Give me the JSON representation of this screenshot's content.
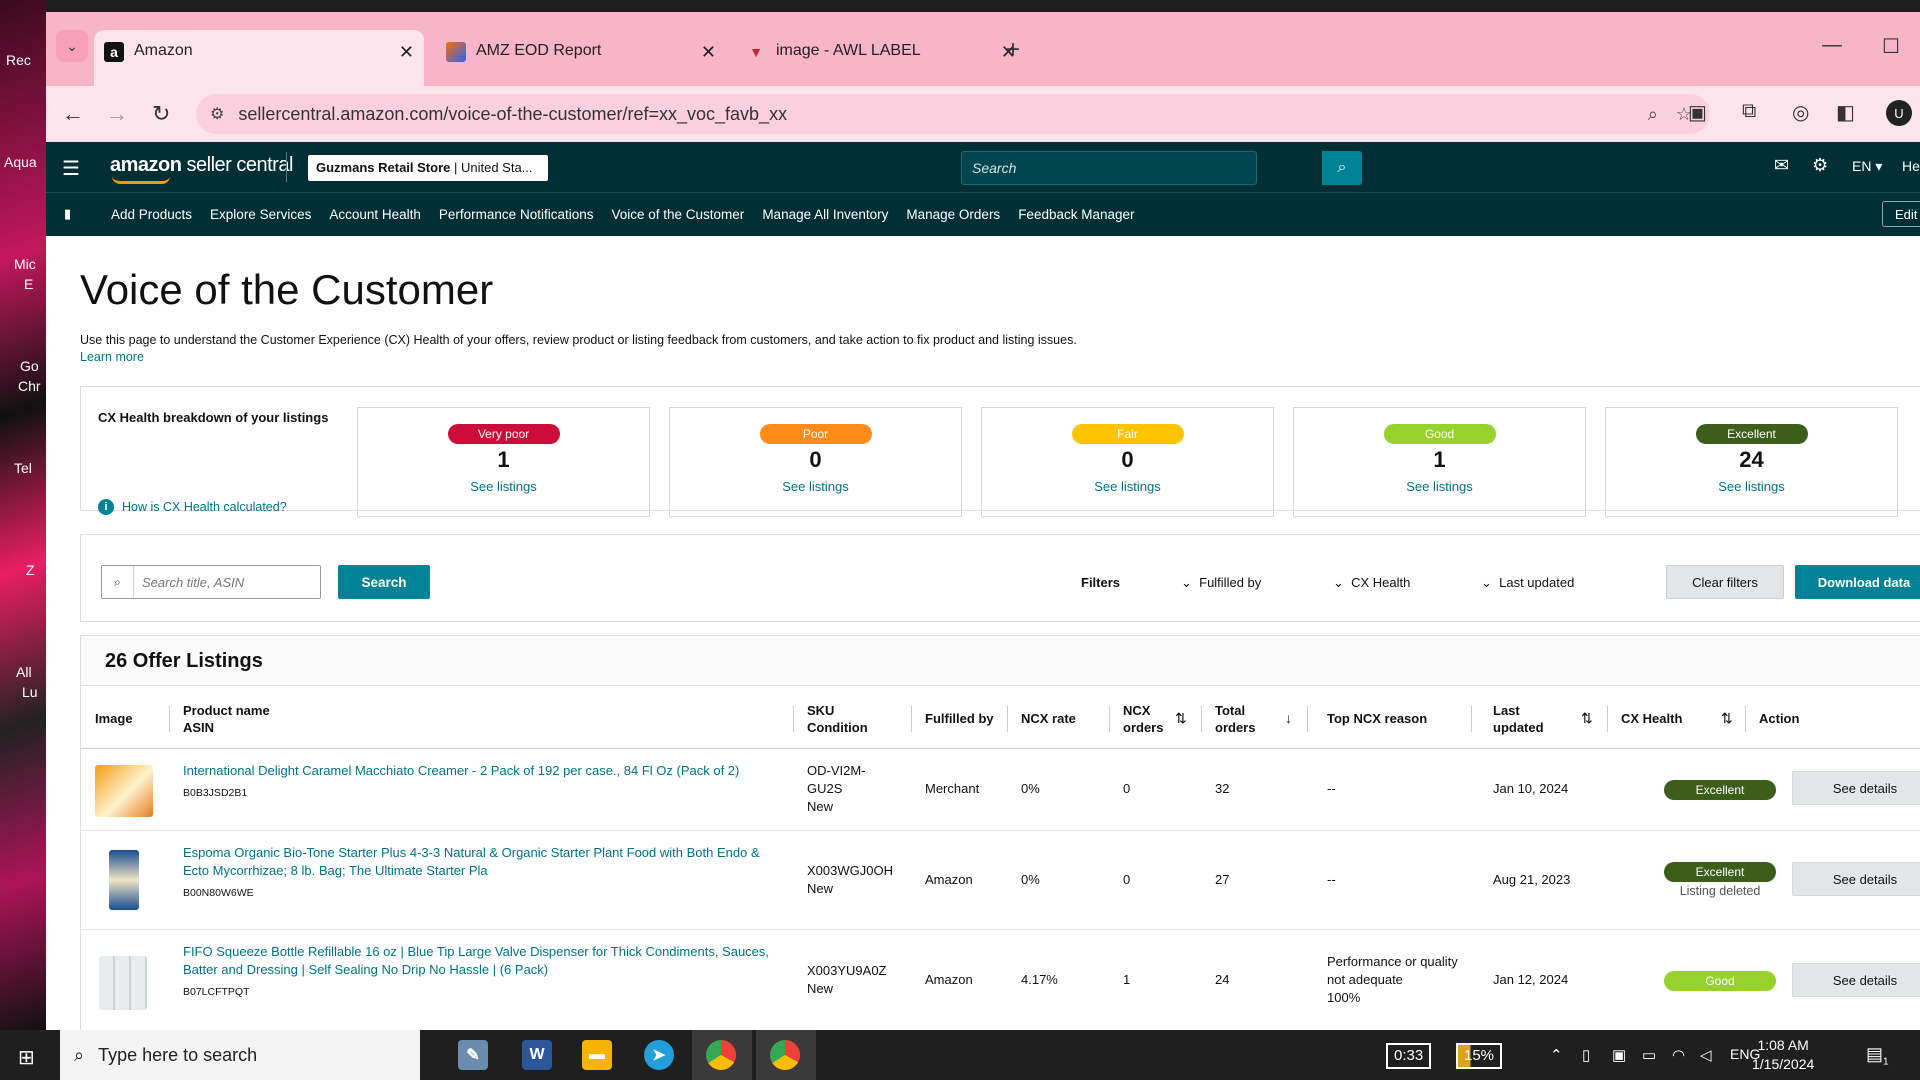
{
  "desktop": {
    "labels": [
      "Rec",
      "Aqua",
      "Mic",
      "E",
      "Go",
      "Chr",
      "Tel",
      "Z",
      "All",
      "Lu"
    ]
  },
  "browser": {
    "tabs": [
      {
        "title": "Amazon",
        "favicon": "a"
      },
      {
        "title": "AMZ EOD Report",
        "favicon": ""
      },
      {
        "title": "image - AWL LABEL",
        "favicon": ""
      }
    ],
    "url": "sellercentral.amazon.com/voice-of-the-customer/ref=xx_voc_favb_xx",
    "avatar": "U"
  },
  "header": {
    "logo_bold": "amazon",
    "logo_rest": " seller central",
    "store_name": "Guzmans Retail Store",
    "store_market": " | United Sta...",
    "search_placeholder": "Search",
    "lang": "EN ▾",
    "help": "He"
  },
  "nav": {
    "items": [
      "Add Products",
      "Explore Services",
      "Account Health",
      "Performance Notifications",
      "Voice of the Customer",
      "Manage All Inventory",
      "Manage Orders",
      "Feedback Manager"
    ],
    "edit": "Edit"
  },
  "page": {
    "title": "Voice of the Customer",
    "description": "Use this page to understand the Customer Experience (CX) Health of your offers, review product or listing feedback from customers, and take action to fix product and listing issues.",
    "learn_more": "Learn more"
  },
  "cx_health": {
    "title": "CX Health breakdown of your listings",
    "how_link": "How is CX Health calculated?",
    "cards": [
      {
        "label": "Very poor",
        "count": "1",
        "link": "See listings",
        "color": "#cc0c39"
      },
      {
        "label": "Poor",
        "count": "0",
        "link": "See listings",
        "color": "#ff8c1a"
      },
      {
        "label": "Fair",
        "count": "0",
        "link": "See listings",
        "color": "#ffc400"
      },
      {
        "label": "Good",
        "count": "1",
        "link": "See listings",
        "color": "#97d12b"
      },
      {
        "label": "Excellent",
        "count": "24",
        "link": "See listings",
        "color": "#3d5d1a"
      }
    ]
  },
  "filters": {
    "search_placeholder": "Search title, ASIN",
    "search_button": "Search",
    "filters_label": "Filters",
    "fulfilled_by": "Fulfilled by",
    "cx_health": "CX Health",
    "last_updated": "Last updated",
    "clear": "Clear filters",
    "download": "Download data"
  },
  "listings": {
    "heading": "26 Offer Listings",
    "columns": {
      "image": "Image",
      "product_name": "Product name",
      "asin": "ASIN",
      "sku": "SKU",
      "condition": "Condition",
      "fulfilled_by": "Fulfilled by",
      "ncx_rate": "NCX rate",
      "ncx_orders_1": "NCX",
      "ncx_orders_2": "orders",
      "total_orders_1": "Total",
      "total_orders_2": "orders",
      "top_reason": "Top NCX reason",
      "last_updated_1": "Last",
      "last_updated_2": "updated",
      "cx_health": "CX Health",
      "action": "Action"
    },
    "rows": [
      {
        "name": "International Delight Caramel Macchiato Creamer - 2 Pack of 192 per case., 84 Fl Oz (Pack of 2)",
        "asin": "B0B3JSD2B1",
        "sku_1": "OD-VI2M-",
        "sku_2": "GU2S",
        "condition": "New",
        "fulfilled": "Merchant",
        "ncx_rate": "0%",
        "ncx_orders": "0",
        "total_orders": "32",
        "reason_1": "--",
        "reason_2": "",
        "reason_3": "",
        "last_updated": "Jan 10, 2024",
        "cx": "Excellent",
        "cx_color": "#3d5d1a",
        "cx_note": "",
        "action": "See details"
      },
      {
        "name_1": "Espoma Organic Bio-Tone Starter Plus 4-3-3 Natural & Organic Starter Plant Food with Both Endo &",
        "name_2": "Ecto Mycorrhizae; 8 lb. Bag; The Ultimate Starter Pla",
        "asin": "B00N80W6WE",
        "sku": "X003WGJ0OH",
        "condition": "New",
        "fulfilled": "Amazon",
        "ncx_rate": "0%",
        "ncx_orders": "0",
        "total_orders": "27",
        "reason_1": "--",
        "last_updated": "Aug 21, 2023",
        "cx": "Excellent",
        "cx_color": "#3d5d1a",
        "cx_note": "Listing deleted",
        "action": "See details"
      },
      {
        "name_1": "FIFO Squeeze Bottle Refillable 16 oz | Blue Tip Large Valve Dispenser for Thick Condiments, Sauces,",
        "name_2": "Batter and Dressing | Self Sealing No Drip No Hassle | (6 Pack)",
        "asin": "B07LCFTPQT",
        "sku": "X003YU9A0Z",
        "condition": "New",
        "fulfilled": "Amazon",
        "ncx_rate": "4.17%",
        "ncx_orders": "1",
        "total_orders": "24",
        "reason_1": "Performance or quality",
        "reason_2": "not adequate",
        "reason_3": "100%",
        "last_updated": "Jan 12, 2024",
        "cx": "Good",
        "cx_color": "#97d12b",
        "action": "See details"
      }
    ]
  },
  "taskbar": {
    "search_text": "Type here to search",
    "battery_timer": "0:33",
    "battery_pct": "15%",
    "lang": "ENG",
    "time": "1:08 AM",
    "date": "1/15/2024",
    "notif_count": "1"
  }
}
